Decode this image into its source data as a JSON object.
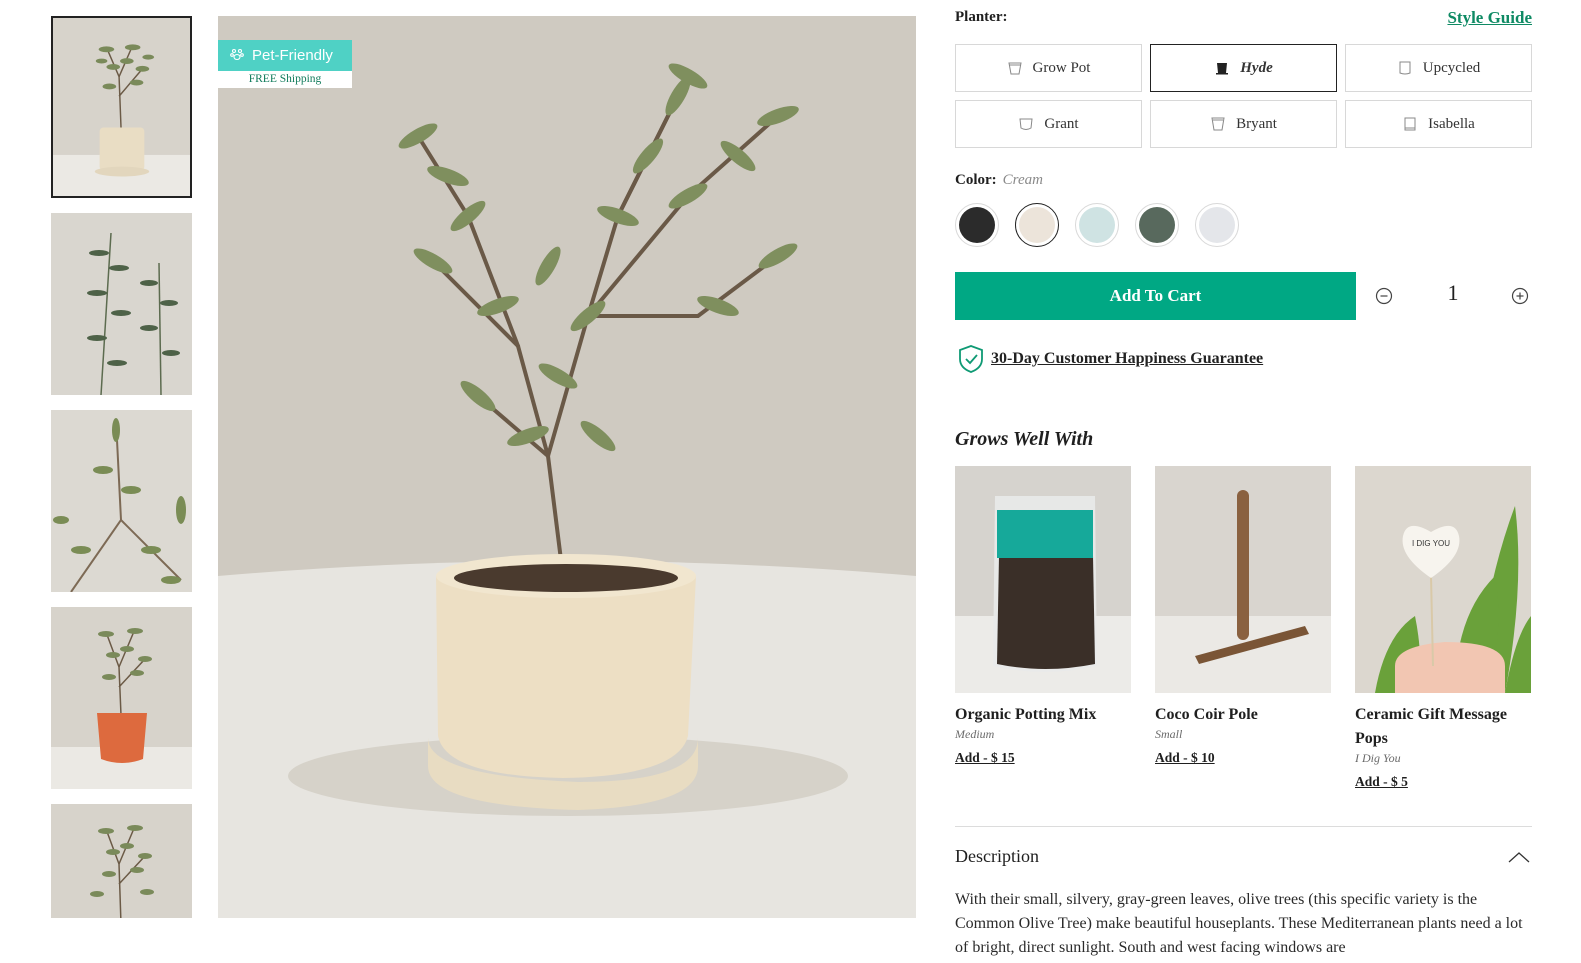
{
  "badge": {
    "title": "Pet-Friendly",
    "subtitle": "FREE Shipping",
    "icon": "paw-icon"
  },
  "gallery": {
    "main_image": "olive-tree-cream-hyde-planter",
    "thumbnails": [
      {
        "name": "olive-tree-cream-planter",
        "selected": true
      },
      {
        "name": "olive-leaves-closeup-1",
        "selected": false
      },
      {
        "name": "olive-leaves-closeup-2",
        "selected": false
      },
      {
        "name": "olive-tree-terracotta-planter",
        "selected": false
      },
      {
        "name": "olive-tree-partial",
        "selected": false
      }
    ]
  },
  "planter": {
    "label": "Planter:",
    "style_guide": "Style Guide",
    "options": [
      {
        "label": "Grow Pot",
        "selected": false
      },
      {
        "label": "Hyde",
        "selected": true
      },
      {
        "label": "Upcycled",
        "selected": false
      },
      {
        "label": "Grant",
        "selected": false
      },
      {
        "label": "Bryant",
        "selected": false
      },
      {
        "label": "Isabella",
        "selected": false
      }
    ]
  },
  "color": {
    "label": "Color:",
    "selected": "Cream",
    "swatches": [
      {
        "name": "black",
        "hex": "#2b2b2b",
        "selected": false
      },
      {
        "name": "cream",
        "hex": "#ece4da",
        "selected": true
      },
      {
        "name": "mint",
        "hex": "#cfe3e3",
        "selected": false
      },
      {
        "name": "green",
        "hex": "#58695d",
        "selected": false
      },
      {
        "name": "light-gray",
        "hex": "#e4e6ea",
        "selected": false
      }
    ]
  },
  "cart": {
    "add_label": "Add To Cart",
    "quantity": "1",
    "accent": "#00a884"
  },
  "guarantee": {
    "text": "30-Day Customer Happiness Guarantee"
  },
  "grows_well_with": {
    "title": "Grows Well With",
    "items": [
      {
        "name": "Organic Potting Mix",
        "variant": "Medium",
        "add": "Add - $ 15"
      },
      {
        "name": "Coco Coir Pole",
        "variant": "Small",
        "add": "Add - $ 10"
      },
      {
        "name": "Ceramic Gift Message Pops",
        "variant": "I Dig You",
        "add": "Add - $ 5",
        "image_text": "I DIG YOU"
      }
    ]
  },
  "description": {
    "title": "Description",
    "body": "With their small, silvery, gray-green leaves, olive trees (this specific variety is the Common Olive Tree) make beautiful houseplants. These Mediterranean plants need a lot of bright, direct sunlight. South and west facing windows are"
  }
}
